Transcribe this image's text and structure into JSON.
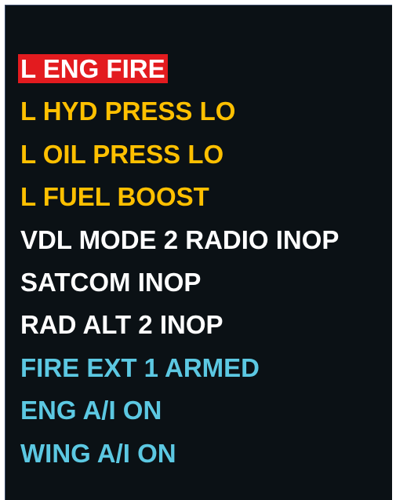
{
  "cas": {
    "messages": [
      {
        "text": "L ENG FIRE",
        "level": "warning"
      },
      {
        "text": "L HYD PRESS LO",
        "level": "caution"
      },
      {
        "text": "L OIL PRESS LO",
        "level": "caution"
      },
      {
        "text": "L FUEL BOOST",
        "level": "caution"
      },
      {
        "text": "VDL MODE 2 RADIO INOP",
        "level": "advisory"
      },
      {
        "text": "SATCOM INOP",
        "level": "advisory"
      },
      {
        "text": "RAD ALT 2 INOP",
        "level": "advisory"
      },
      {
        "text": "FIRE EXT 1 ARMED",
        "level": "status"
      },
      {
        "text": "ENG A/I ON",
        "level": "status"
      },
      {
        "text": "WING A/I ON",
        "level": "status"
      }
    ]
  },
  "colors": {
    "background": "#0b1115",
    "warning_bg": "#e31b1f",
    "warning_text": "#ffffff",
    "caution": "#ffc000",
    "advisory": "#ffffff",
    "status": "#5cc8e2"
  }
}
